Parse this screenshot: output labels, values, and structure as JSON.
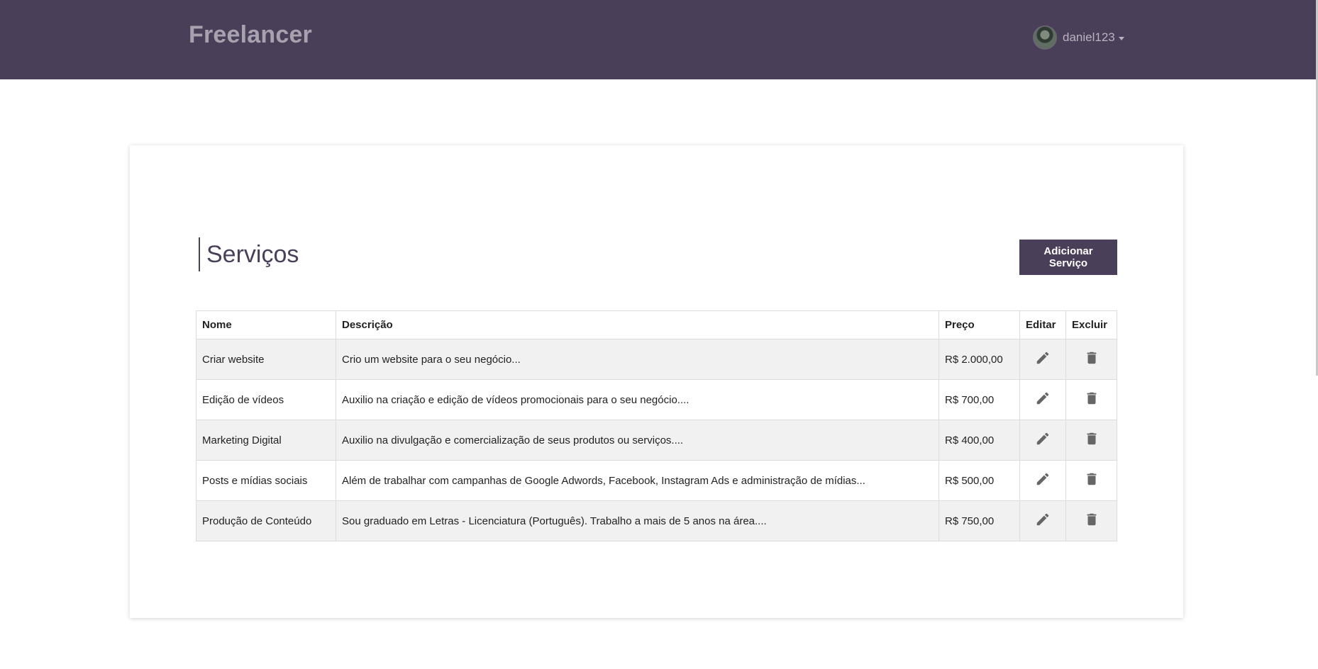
{
  "navbar": {
    "brand": "Freelancer",
    "username": "daniel123",
    "background_color": "#4a3f59"
  },
  "page": {
    "title": "Serviços",
    "add_button_label": "Adicionar Serviço"
  },
  "table": {
    "headers": {
      "name": "Nome",
      "description": "Descrição",
      "price": "Preço",
      "edit": "Editar",
      "delete": "Excluir"
    },
    "rows": [
      {
        "name": "Criar website",
        "description": "Crio um website para o seu negócio...",
        "price": "R$ 2.000,00",
        "edit_icon": "pencil-icon",
        "delete_icon": "trash-icon"
      },
      {
        "name": "Edição de vídeos",
        "description": "Auxilio na criação e edição de vídeos promocionais para o seu negócio....",
        "price": "R$ 700,00",
        "edit_icon": "pencil-icon",
        "delete_icon": "trash-icon"
      },
      {
        "name": "Marketing Digital",
        "description": "Auxilio na divulgação e comercialização de seus produtos ou serviços....",
        "price": "R$ 400,00",
        "edit_icon": "pencil-icon",
        "delete_icon": "trash-icon"
      },
      {
        "name": "Posts e mídias sociais",
        "description": "Além de trabalhar com campanhas de Google Adwords, Facebook, Instagram Ads e administração de mídias...",
        "price": "R$ 500,00",
        "edit_icon": "pencil-icon",
        "delete_icon": "trash-icon"
      },
      {
        "name": "Produção de Conteúdo",
        "description": "Sou graduado em Letras - Licenciatura (Português). Trabalho a mais de 5 anos na área....",
        "price": "R$ 750,00",
        "edit_icon": "pencil-icon",
        "delete_icon": "trash-icon"
      }
    ]
  },
  "colors": {
    "accent": "#4a3f59",
    "row_stripe": "#f1f1f1",
    "icon": "#666666"
  }
}
